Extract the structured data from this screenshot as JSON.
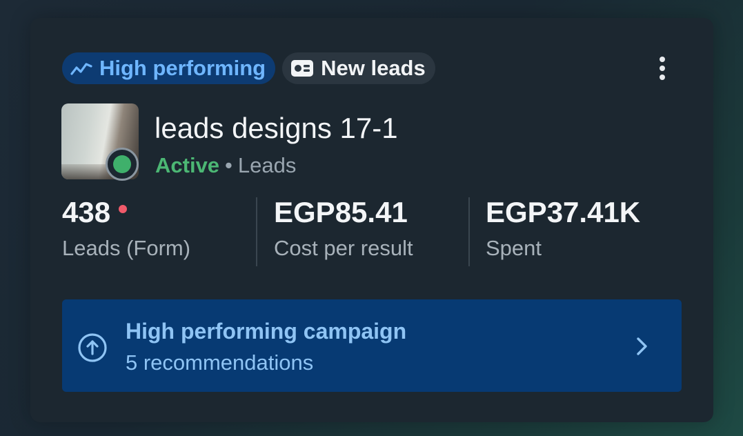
{
  "badges": {
    "high_performing": "High performing",
    "new_leads": "New leads"
  },
  "campaign": {
    "name": "leads designs 17-1",
    "status": "Active",
    "separator": "•",
    "objective": "Leads"
  },
  "metrics": [
    {
      "value": "438",
      "label": "Leads (Form)"
    },
    {
      "value": "EGP85.41",
      "label": "Cost per result"
    },
    {
      "value": "EGP37.41K",
      "label": "Spent"
    }
  ],
  "recommendation": {
    "title": "High performing campaign",
    "subtitle": "5 recommendations"
  },
  "icons": {
    "trend": "trend-up-icon",
    "card": "id-card-icon",
    "more": "more-vertical-icon",
    "arrow_up_circle": "arrow-up-circle-icon",
    "chevron": "chevron-right-icon"
  },
  "colors": {
    "card_bg": "#1c2730",
    "high_badge_bg": "#0d3b72",
    "high_badge_text": "#6fb6ff",
    "active_green": "#4cb774",
    "alert_dot": "#f05a6a",
    "reco_bg": "#073a73",
    "reco_text": "#8fc4f4"
  }
}
